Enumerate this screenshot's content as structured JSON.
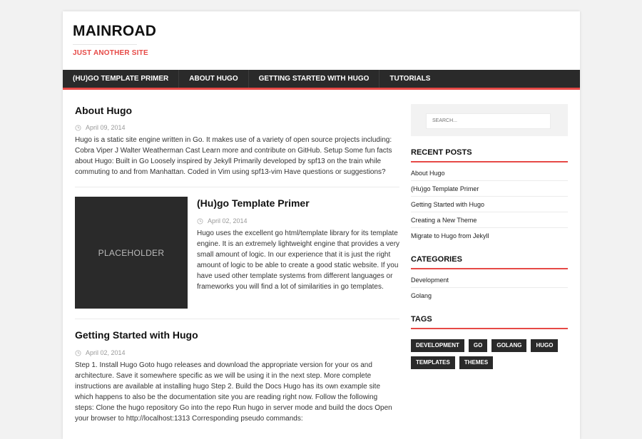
{
  "site": {
    "title": "MAINROAD",
    "subtitle": "JUST ANOTHER SITE"
  },
  "menu": [
    {
      "label": "(HU)GO TEMPLATE PRIMER"
    },
    {
      "label": "ABOUT HUGO"
    },
    {
      "label": "GETTING STARTED WITH HUGO"
    },
    {
      "label": "TUTORIALS"
    }
  ],
  "posts": [
    {
      "title": "About Hugo",
      "date": "April 09, 2014",
      "excerpt": "Hugo is a static site engine written in Go. It makes use of a variety of open source projects including: Cobra Viper J Walter Weatherman Cast Learn more and contribute on GitHub. Setup Some fun facts about Hugo: Built in Go Loosely inspired by Jekyll Primarily developed by spf13 on the train while commuting to and from Manhattan. Coded in Vim using spf13-vim Have questions or suggestions?"
    },
    {
      "title": "(Hu)go Template Primer",
      "date": "April 02, 2014",
      "thumbnail_text": "PLACEHOLDER",
      "excerpt": "Hugo uses the excellent go html/template library for its template engine. It is an extremely lightweight engine that provides a very small amount of logic. In our experience that it is just the right amount of logic to be able to create a good static website. If you have used other template systems from different languages or frameworks you will find a lot of similarities in go templates."
    },
    {
      "title": "Getting Started with Hugo",
      "date": "April 02, 2014",
      "excerpt": "Step 1. Install Hugo Goto hugo releases and download the appropriate version for your os and architecture. Save it somewhere specific as we will be using it in the next step. More complete instructions are available at installing hugo Step 2. Build the Docs Hugo has its own example site which happens to also be the documentation site you are reading right now. Follow the following steps: Clone the hugo repository Go into the repo Run hugo in server mode and build the docs Open your browser to http://localhost:1313 Corresponding pseudo commands:"
    }
  ],
  "sidebar": {
    "search_placeholder": "SEARCH...",
    "recent_posts": {
      "title": "RECENT POSTS",
      "items": [
        "About Hugo",
        "(Hu)go Template Primer",
        "Getting Started with Hugo",
        "Creating a New Theme",
        "Migrate to Hugo from Jekyll"
      ]
    },
    "categories": {
      "title": "CATEGORIES",
      "items": [
        "Development",
        "Golang"
      ]
    },
    "tags": {
      "title": "TAGS",
      "items": [
        "DEVELOPMENT",
        "GO",
        "GOLANG",
        "HUGO",
        "TEMPLATES",
        "THEMES"
      ]
    }
  },
  "colors": {
    "accent": "#e64946",
    "dark": "#2a2a2a"
  }
}
